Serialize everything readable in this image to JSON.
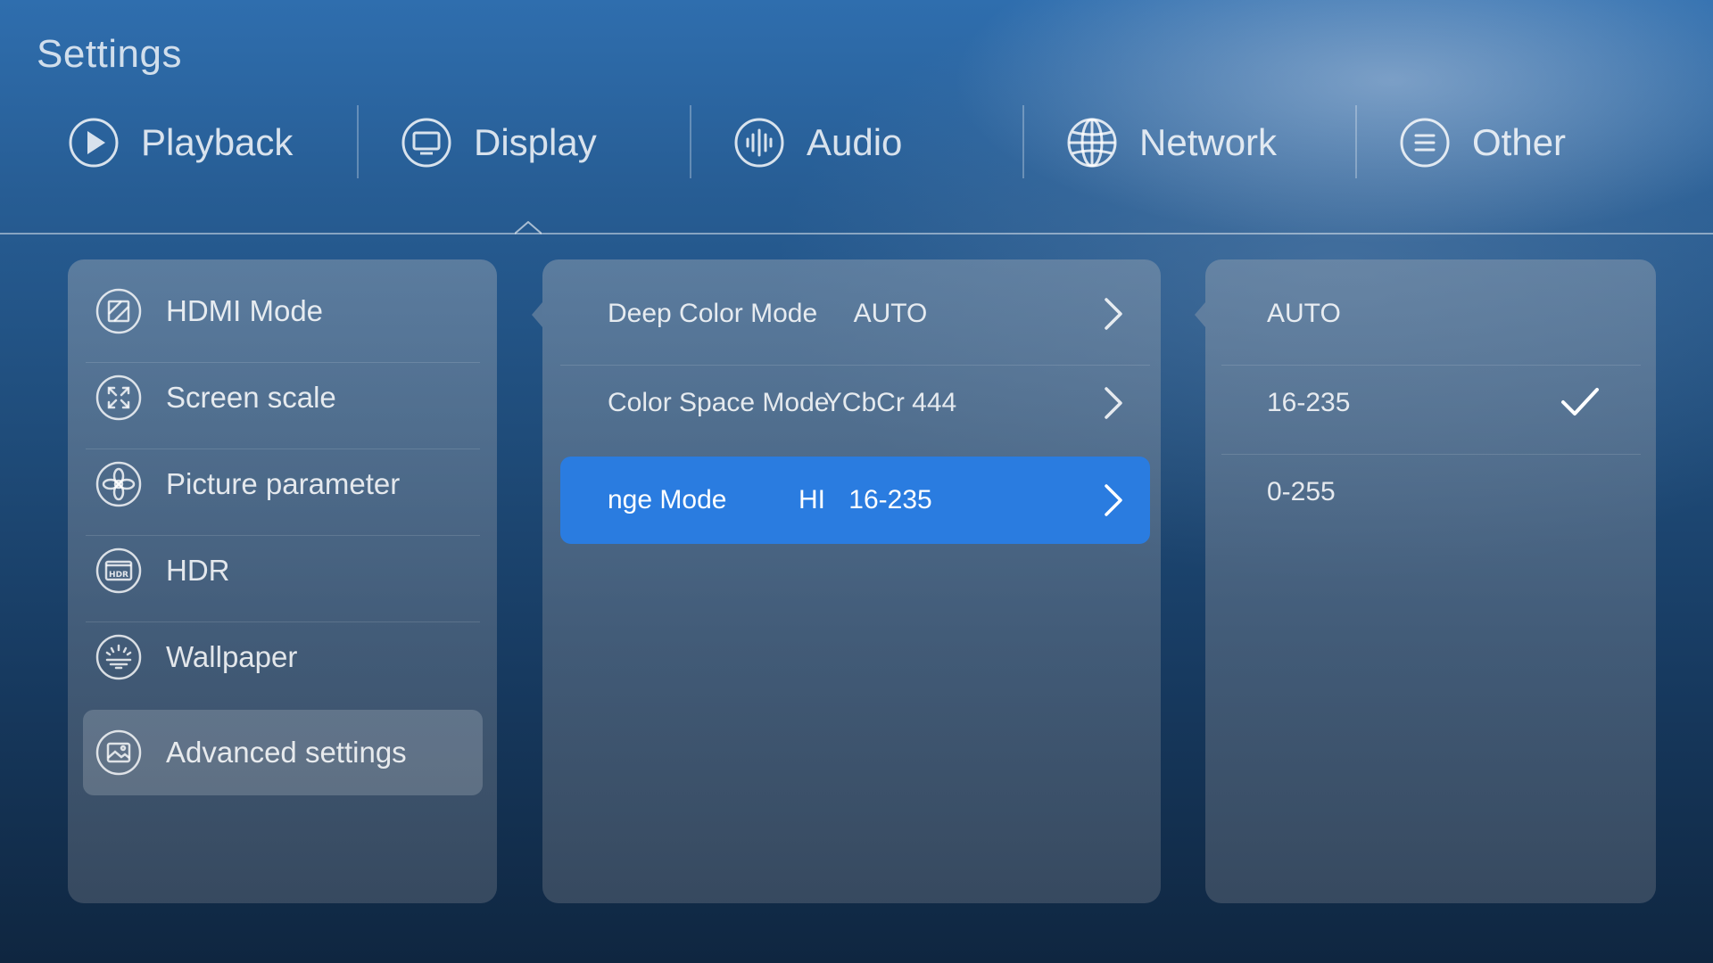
{
  "page": {
    "title": "Settings"
  },
  "tabs": [
    {
      "label": "Playback",
      "icon": "play-icon"
    },
    {
      "label": "Display",
      "icon": "monitor-icon"
    },
    {
      "label": "Audio",
      "icon": "audio-wave-icon"
    },
    {
      "label": "Network",
      "icon": "globe-icon"
    },
    {
      "label": "Other",
      "icon": "menu-list-icon"
    }
  ],
  "active_tab": "Display",
  "sidebar": {
    "items": [
      {
        "label": "HDMI Mode",
        "icon": "hdmi-icon"
      },
      {
        "label": "Screen scale",
        "icon": "scale-icon"
      },
      {
        "label": "Picture parameter",
        "icon": "aperture-icon"
      },
      {
        "label": "HDR",
        "icon": "hdr-icon"
      },
      {
        "label": "Wallpaper",
        "icon": "wallpaper-icon"
      },
      {
        "label": "Advanced settings",
        "icon": "image-icon"
      }
    ],
    "selected": "Advanced settings"
  },
  "options": [
    {
      "name": "Deep Color Mode",
      "value": "AUTO"
    },
    {
      "name": "Color Space Mode",
      "value": "YCbCr 444"
    },
    {
      "name": "Color Range Mode",
      "name_visible": "nge Mode",
      "name_visible_tail": "HI",
      "value": "16-235"
    }
  ],
  "choices": {
    "items": [
      {
        "label": "AUTO"
      },
      {
        "label": "16-235"
      },
      {
        "label": "0-255"
      }
    ],
    "checked": "16-235"
  },
  "colors": {
    "accent": "#2a7ce0",
    "background_top": "#2f6eae",
    "background_bottom": "#0f2640"
  }
}
